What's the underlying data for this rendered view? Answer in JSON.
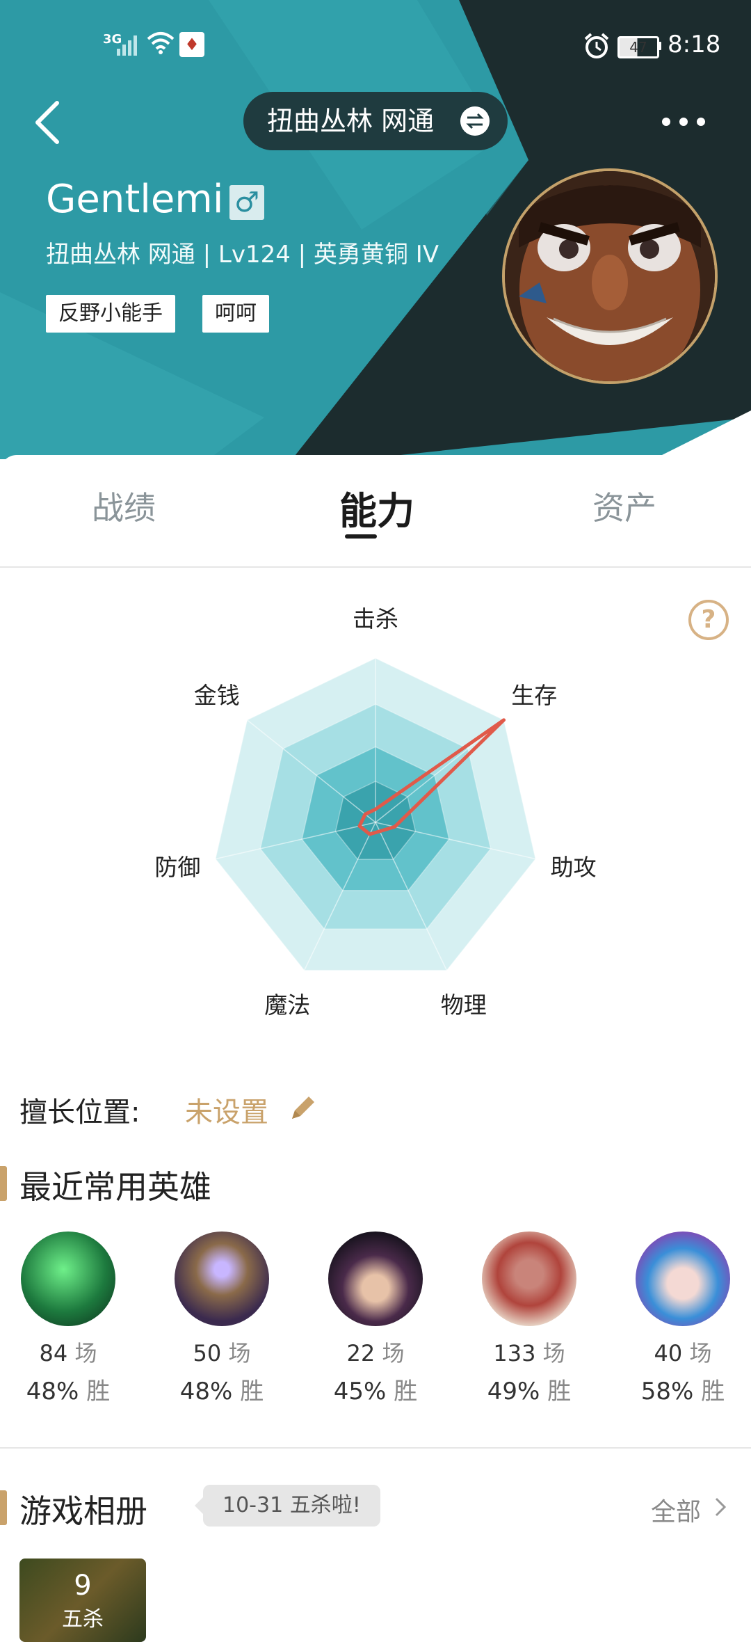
{
  "status_bar": {
    "network": "3G",
    "battery": "47",
    "time": "8:18"
  },
  "header": {
    "server_switch": "扭曲丛林 网通",
    "player_name": "Gentlemi",
    "gender_icon": "male-icon",
    "player_info": "扭曲丛林 网通 | Lv124 | 英勇黄铜 IV",
    "tags": [
      "反野小能手",
      "呵呵"
    ],
    "colors": {
      "teal": "#2d9aa5",
      "dark": "#1c2c2e",
      "gold": "#c4a16a"
    }
  },
  "tabs": [
    {
      "label": "战绩"
    },
    {
      "label": "能力"
    },
    {
      "label": "资产"
    }
  ],
  "active_tab": "能力",
  "radar": {
    "labels": [
      "击杀",
      "生存",
      "助攻",
      "物理",
      "魔法",
      "防御",
      "金钱"
    ],
    "max": 100,
    "values": [
      8,
      100,
      12,
      6,
      8,
      10,
      8
    ],
    "colors": {
      "ring_outer": "#d6f0f2",
      "ring_2": "#a6dfe4",
      "ring_3": "#62c2cb",
      "ring_inner": "#3aa3ad",
      "stroke": "#e05a4a"
    }
  },
  "position": {
    "label": "擅长位置:",
    "value": "未设置"
  },
  "recent_heroes": {
    "title": "最近常用英雄",
    "items": [
      {
        "games": "84",
        "games_unit": "场",
        "win": "48%",
        "win_unit": "胜"
      },
      {
        "games": "50",
        "games_unit": "场",
        "win": "48%",
        "win_unit": "胜"
      },
      {
        "games": "22",
        "games_unit": "场",
        "win": "45%",
        "win_unit": "胜"
      },
      {
        "games": "133",
        "games_unit": "场",
        "win": "49%",
        "win_unit": "胜"
      },
      {
        "games": "40",
        "games_unit": "场",
        "win": "58%",
        "win_unit": "胜"
      }
    ]
  },
  "album": {
    "title": "游戏相册",
    "bubble": "10-31 五杀啦!",
    "all": "全部",
    "item_count": "9",
    "item_label": "五杀"
  }
}
